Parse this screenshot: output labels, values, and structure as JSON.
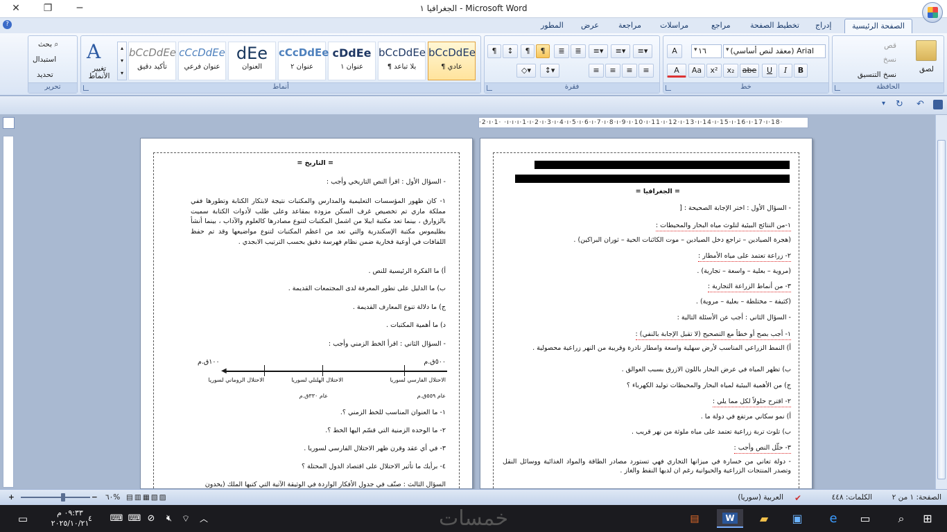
{
  "window": {
    "title": "الجغرافيا ١ - Microsoft Word"
  },
  "tabs": [
    "الصفحة الرئيسية",
    "إدراج",
    "تخطيط الصفحة",
    "مراجع",
    "مراسلات",
    "مراجعة",
    "عرض",
    "المطور"
  ],
  "clipboard": {
    "paste": "لصق",
    "cut": "قص",
    "copy": "نسخ",
    "format_painter": "نسخ التنسيق",
    "label": "الحافظة"
  },
  "font": {
    "name": "Arial (معقد لنص أساسي)",
    "size": "١٦",
    "label": "خط"
  },
  "paragraph": {
    "label": "فقرة"
  },
  "styles": {
    "label": "أنماط",
    "items": [
      {
        "preview": "bCcDdEe",
        "name": "¶ عادي"
      },
      {
        "preview": "bCcDdEe",
        "name": "¶ بلا تباعد"
      },
      {
        "preview": "cDdEe",
        "name": "عنوان ١"
      },
      {
        "preview": "cCcDdEe",
        "name": "عنوان ٢"
      },
      {
        "preview": "dEe",
        "name": "العنوان"
      },
      {
        "preview": "cCcDdEe",
        "name": "عنوان فرعي"
      },
      {
        "preview": "bCcDdEe",
        "name": "تأكيد دقيق"
      }
    ],
    "change": "تغيير الأنماط"
  },
  "editing": {
    "find": "بحث",
    "replace": "استبدال",
    "select": "تحديد",
    "label": "تحرير"
  },
  "ruler": {
    "text": "·2·ı·1· ·ı·ı·ı·1·ı·2·ı·3·ı·4·ı·5·ı·6·ı·7·ı·8·ı·9·ı·10·ı·11·ı·12·ı·13·ı·14·ı·15·ı·16·ı·17·ı·18·"
  },
  "page_right": {
    "title": "= الجغرافيا =",
    "q1": "- السؤال الأول : اختر الإجابة الصحيحة : [",
    "q1_1": "١-من النتائج البيئية لتلوث مياه البحار والمحيطات :",
    "q1_1a": "(هجرة الصيادين – تراجع دخل الصيادين – موت الكائنات الحية – ثوران البراكين) .",
    "q1_2": "٢- زراعة تعتمد على مياه الأمطار :",
    "q1_2a": "(مروية – بعلية – واسعة – تجارية) .",
    "q1_3": "٣- من أنماط الزراعة التجارية :",
    "q1_3a": "(كثيفة – مختلطة – بعلية – مروية) .",
    "q2": "- السؤال الثاني : أجب عن الأسئلة التالية :",
    "q2_1": "١- أجب بصح أو خطأ مع التصحيح (لا تقبل الإجابة بالنفي) :",
    "q2_1a": "أ)  النمط الزراعي المناسب لأرض سهلية واسعة وامطار نادرة وقريبة من النهر زراعية محصولية .",
    "q2_1b": "ب) تظهر المياه في عرض البحار باللون الازرق بسبب العوالق .",
    "q2_1c": "ج) من الأهمية البيئية لمياه البحار والمحيطات توليد الكهرباء ؟",
    "q2_2": "٢- اقترح حلولاً لكل مما يلي :",
    "q2_2a": "أ) نمو سكاني مرتفع في دولة ما .",
    "q2_2b": "ب) تلوث تربة زراعية تعتمد على مياه ملوثة من نهر قريب .",
    "q2_3": "٣- حلّل النص وأجب :",
    "q2_3a": "- دولة تعاني من خسارة في ميزانها التجاري فهي تستورد مصادر الطاقة والمواد الغذائية ووسائل النقل وتصدر المنتجات الزراعية والحيوانية رغم ان لديها النفط والغاز ."
  },
  "page_left": {
    "title": "= التاريخ =",
    "q1": "- السؤال الأول : اقرأ النص التاريخي وأجب :",
    "passage": "١- كان ظهور المؤسسات التعليمية والمدارس والمكتبات نتيجة لابتكار الكتابة وتطورها ففي مملكة ماري تم تخصيص غرف السكن مزوده بمقاعد وعلى طلب لأدوات الكتابة سميت بالزوارق ، بينما تعد مكتبة ايبلا من اشمل المكتبات لتنوع مصادرها كالعلوم والآداب ، بينما أنشأ بطليموس مكتبة الإسكندرية والتي تعد من اعظم المكتبات لتنوع مواضيعها وقد تم حفظ اللفافات في أوعية فخارية ضمن نظام فهرسة دقيق بحسب الترتيب الابجدي .",
    "qa": "أ) ما الفكرة الرئيسية للنص .",
    "qb": "ب) ما الدليل على تطور المعرفة لدى المجتمعات القديمة .",
    "qc": "ج) ما دلالة تنوع المعارف القديمة .",
    "qd": "د) ما أهمية المكتبات .",
    "q2": "- السؤال الثاني : اقرأ الخط الزمني وأجب :",
    "tl_right_year": "٥٠٠ق.م",
    "tl_left_year": "١٠٠ق.م",
    "tl_e1": "الاحتلال الفارسي لسوريا",
    "tl_e2": "الاحتلال الهلنلي لسوريا",
    "tl_e3": "الاحتلال الروماني لسوريا",
    "tl_d1": "عام ٥٥٩ق.م",
    "tl_d2": "عام ٣٣٠ق.م",
    "l1": "١- ما العنوان المناسب للخط الزمني ؟.",
    "l2": "٢- ما الوحده الزمنية التي قسّم اليها الخط ؟.",
    "l3": "٣- في أي عقد وقرن ظهر الاحتلال الفارسي لسوريا .",
    "l4": "٤- برأيك ما تأثير الاحتلال على اقتصاد الدول المحتلة ؟",
    "q3": "السؤال الثالث : صنّف في جدول الأفكار الواردة في الوثيقة الآتية التي كتبها الملك (يخدون"
  },
  "status": {
    "page": "الصفحة: ١ من ٢",
    "words": "الكلمات: ٤٤٨",
    "language": "العربية (سوريا)",
    "zoom": "٦٠%"
  },
  "taskbar": {
    "time": "٠٩:٣٣ م",
    "date": "٢٠٢٥/١٠/٢١",
    "badge": "٤"
  },
  "watermark": "خمسات"
}
